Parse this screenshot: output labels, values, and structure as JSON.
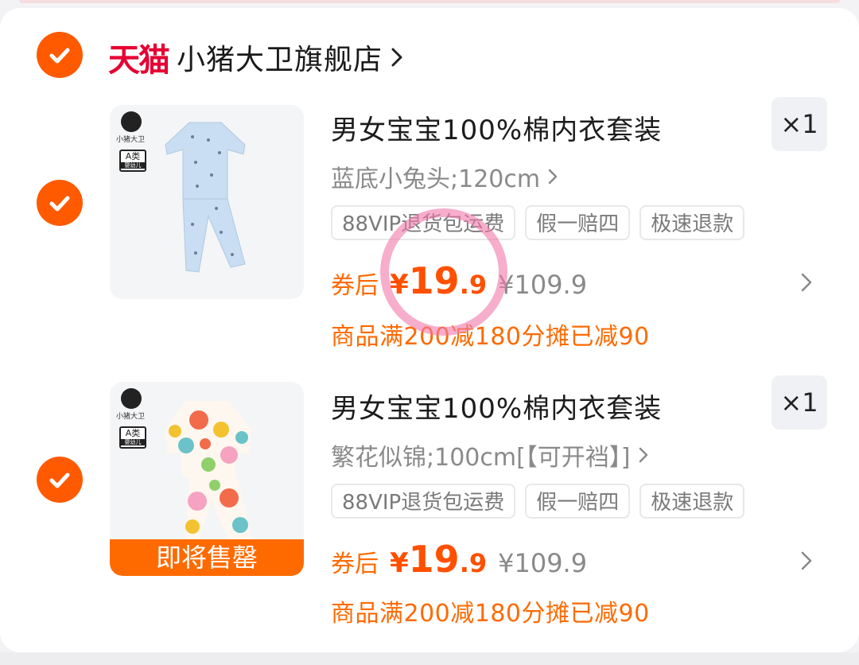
{
  "shop": {
    "platform_logo": "天猫",
    "name": "小猪大卫旗舰店",
    "chevron_icon": "chevron-right-icon"
  },
  "items": [
    {
      "title": "男女宝宝100%棉内衣套装",
      "spec": "蓝底小兔头;120cm",
      "quantity": "×1",
      "tags": [
        "88VIP退货包运费",
        "假一赔四",
        "极速退款"
      ],
      "price_label": "券后",
      "price_currency": "¥",
      "price_integer": "19",
      "price_decimal": ".9",
      "original_price": "¥109.9",
      "discount_note": "商品满200减180分摊已减90",
      "brand_logo_text": "小猪大卫",
      "badge_top": "A类",
      "badge_bottom": "婴幼儿"
    },
    {
      "title": "男女宝宝100%棉内衣套装",
      "spec": "繁花似锦;100cm[【可开裆】]",
      "quantity": "×1",
      "tags": [
        "88VIP退货包运费",
        "假一赔四",
        "极速退款"
      ],
      "price_label": "券后",
      "price_currency": "¥",
      "price_integer": "19",
      "price_decimal": ".9",
      "original_price": "¥109.9",
      "discount_note": "商品满200减180分摊已减90",
      "brand_logo_text": "小猪大卫",
      "badge_top": "A类",
      "badge_bottom": "婴幼儿",
      "stock_status": "即将售罄"
    }
  ],
  "colors": {
    "accent_orange": "#ff5a00",
    "price_orange": "#ff5000",
    "tmall_red": "#e60033",
    "annotation_pink": "#f078aa"
  }
}
